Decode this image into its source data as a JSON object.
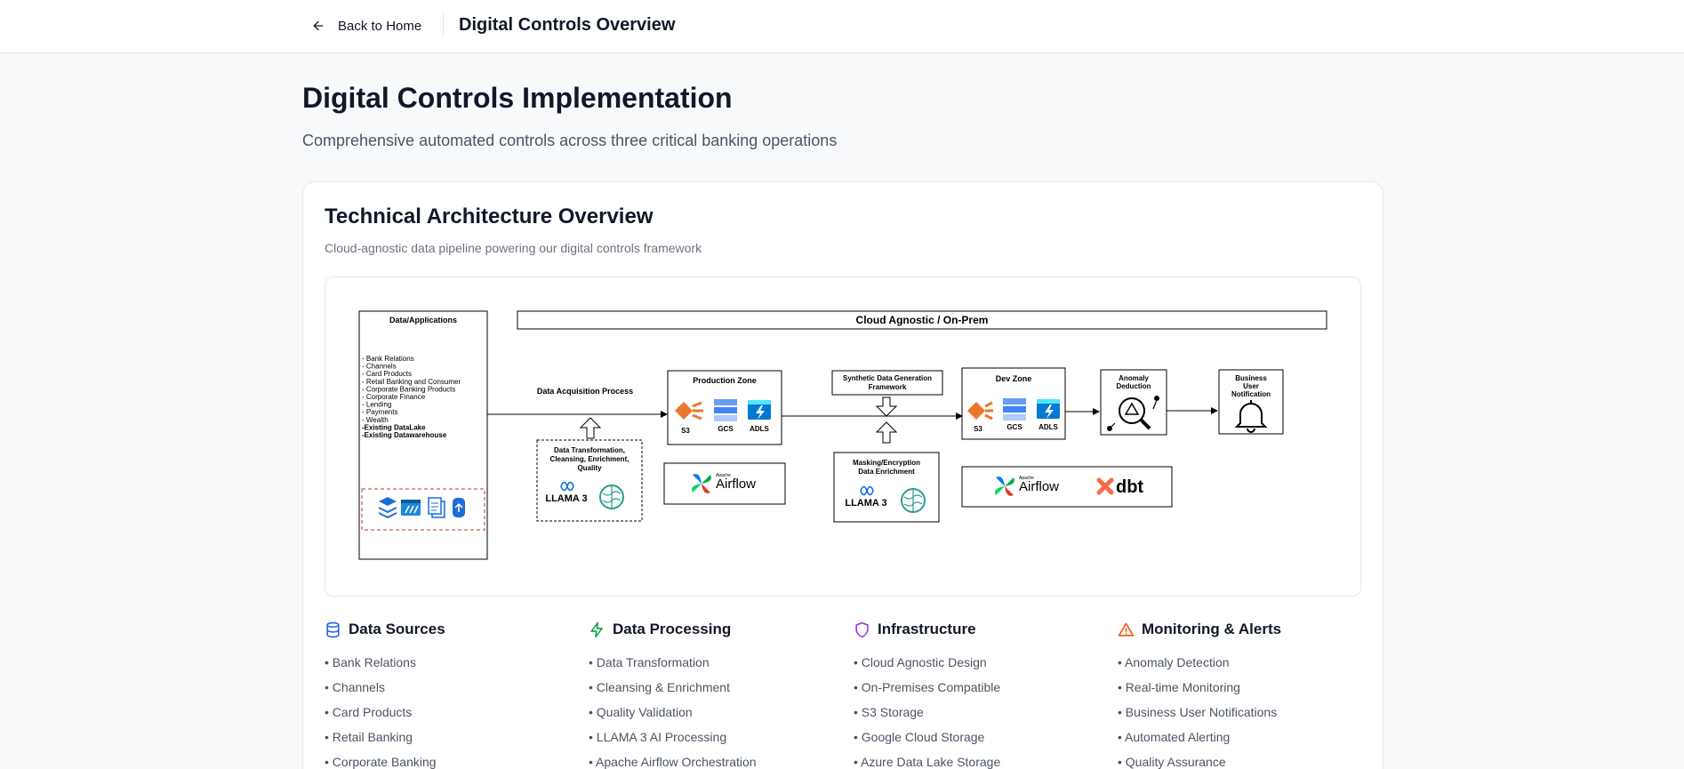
{
  "topbar": {
    "back_label": "Back to Home",
    "title": "Digital Controls Overview"
  },
  "page": {
    "title": "Digital Controls Implementation",
    "subtitle": "Comprehensive automated controls across three critical banking operations"
  },
  "architecture": {
    "title": "Technical Architecture Overview",
    "subtitle": "Cloud-agnostic data pipeline powering our digital controls framework",
    "diagram": {
      "data_apps_title": "Data/Applications",
      "data_apps_items": [
        "- Bank Relations",
        "- Channels",
        "- Card Products",
        "- Retail Banking and Consumer",
        "- Corporate Banking Products",
        "- Corporate Finance",
        "- Lending",
        "- Payments",
        "- Wealth"
      ],
      "data_apps_bold_items": [
        "-Existing DataLake",
        "-Existing Datawarehouse"
      ],
      "cloud_label": "Cloud Agnostic / On-Prem",
      "acquisition_label": "Data Acquisition Process",
      "transform_label": [
        "Data Transformation,",
        "Cleansing, Enrichment,",
        "Quality"
      ],
      "llama_label": "LLAMA 3",
      "production_zone": "Production Zone",
      "storage_labels": [
        "S3",
        "GCS",
        "ADLS"
      ],
      "airflow_small": "Apache",
      "airflow_label": "Airflow",
      "synthetic_label": [
        "Synthetic Data Generation",
        "Framework"
      ],
      "masking_label": [
        "Masking/Encryption",
        "Data Enrichment"
      ],
      "dev_zone": "Dev Zone",
      "dbt_label": "dbt",
      "anomaly_label": [
        "Anomaly",
        "Deduction"
      ],
      "notification_label": [
        "Business",
        "User",
        "Notification"
      ]
    }
  },
  "columns": [
    {
      "title": "Data Sources",
      "icon": "database-icon",
      "color": "#2563eb",
      "items": [
        "Bank Relations",
        "Channels",
        "Card Products",
        "Retail Banking",
        "Corporate Banking"
      ]
    },
    {
      "title": "Data Processing",
      "icon": "zap-icon",
      "color": "#16a34a",
      "items": [
        "Data Transformation",
        "Cleansing & Enrichment",
        "Quality Validation",
        "LLAMA 3 AI Processing",
        "Apache Airflow Orchestration"
      ]
    },
    {
      "title": "Infrastructure",
      "icon": "shield-icon",
      "color": "#9333ea",
      "items": [
        "Cloud Agnostic Design",
        "On-Premises Compatible",
        "S3 Storage",
        "Google Cloud Storage",
        "Azure Data Lake Storage"
      ]
    },
    {
      "title": "Monitoring & Alerts",
      "icon": "alert-triangle-icon",
      "color": "#ea580c",
      "items": [
        "Anomaly Detection",
        "Real-time Monitoring",
        "Business User Notifications",
        "Automated Alerting",
        "Quality Assurance"
      ]
    }
  ]
}
